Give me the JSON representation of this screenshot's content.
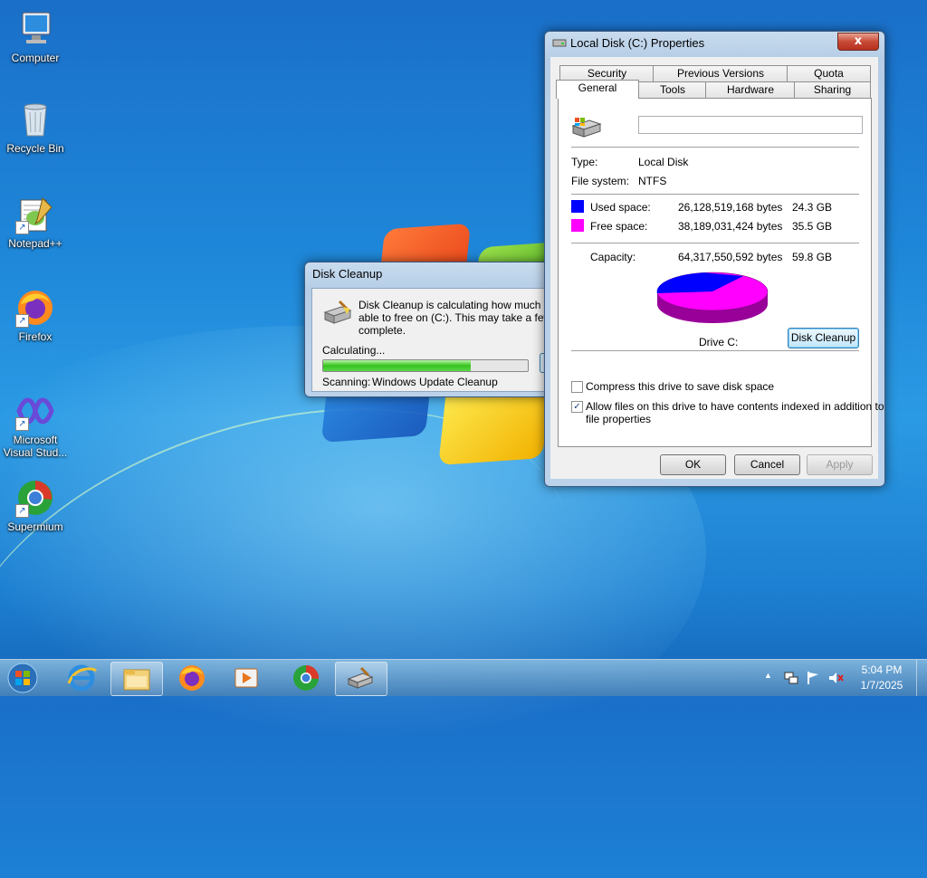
{
  "desktop": {
    "icons": [
      {
        "label": "Computer",
        "icon": "computer-icon"
      },
      {
        "label": "Recycle Bin",
        "icon": "recycle-bin-icon"
      },
      {
        "label": "Notepad++",
        "icon": "notepad-plus-plus-icon"
      },
      {
        "label": "Firefox",
        "icon": "firefox-icon"
      },
      {
        "label": "Microsoft Visual Stud...",
        "icon": "visual-studio-icon"
      },
      {
        "label": "Supermium",
        "icon": "supermium-icon"
      }
    ]
  },
  "cleanup_dialog": {
    "title": "Disk Cleanup",
    "message_line1": "Disk Cleanup is calculating how much space",
    "message_line2": "able to free on  (C:). This may take a few mi",
    "message_line3": "complete.",
    "calculating_label": "Calculating...",
    "progress_fraction": 0.72,
    "scanning_label": "Scanning:",
    "scanning_value": "Windows Update Cleanup"
  },
  "properties": {
    "title": "Local Disk (C:) Properties",
    "close_symbol": "x",
    "tabs_row1": [
      "Security",
      "Previous Versions",
      "Quota"
    ],
    "tabs_row2": [
      "General",
      "Tools",
      "Hardware",
      "Sharing"
    ],
    "active_tab": "General",
    "volume_name": "",
    "type_label": "Type:",
    "type_value": "Local Disk",
    "fs_label": "File system:",
    "fs_value": "NTFS",
    "used_label": "Used space:",
    "used_bytes": "26,128,519,168 bytes",
    "used_gb": "24.3 GB",
    "free_label": "Free space:",
    "free_bytes": "38,189,031,424 bytes",
    "free_gb": "35.5 GB",
    "capacity_label": "Capacity:",
    "capacity_bytes": "64,317,550,592 bytes",
    "capacity_gb": "59.8 GB",
    "drive_label": "Drive C:",
    "disk_cleanup_button": "Disk Cleanup",
    "compress_label": "Compress this drive to save disk space",
    "compress_checked": false,
    "index_label_line1": "Allow files on this drive to have contents indexed in addition to",
    "index_label_line2": "file properties",
    "index_checked": true,
    "ok_button": "OK",
    "cancel_button": "Cancel",
    "apply_button": "Apply",
    "used_color": "#0000ff",
    "free_color": "#ff00ff"
  },
  "taskbar": {
    "items": [
      "start-orb-icon",
      "internet-explorer-icon",
      "file-explorer-icon",
      "firefox-icon",
      "media-player-icon",
      "supermium-icon",
      "disk-cleanup-icon"
    ],
    "tray_expand": "▲",
    "time": "5:04 PM",
    "date": "1/7/2025"
  }
}
